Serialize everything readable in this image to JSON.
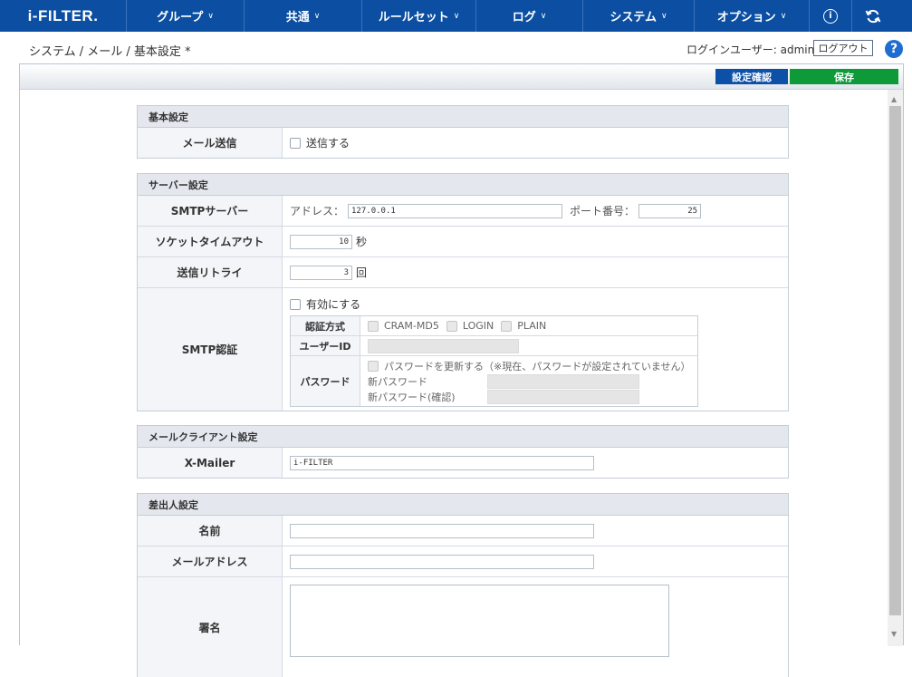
{
  "nav": {
    "logo": "i-FILTER.",
    "items": [
      {
        "label": "グループ"
      },
      {
        "label": "共通"
      },
      {
        "label": "ルールセット"
      },
      {
        "label": "ログ"
      },
      {
        "label": "システム"
      },
      {
        "label": "オプション"
      }
    ],
    "icons": [
      "info-icon",
      "refresh-icon"
    ]
  },
  "breadcrumb": "システム / メール / 基本設定 *",
  "login_user": "ログインユーザー: admin",
  "logout_label": "ログアウト",
  "help_glyph": "?",
  "toolbar": {
    "confirm_label": "設定確認",
    "save_label": "保存"
  },
  "basic": {
    "title": "基本設定",
    "mail_send_label": "メール送信",
    "mail_send_option": "送信する"
  },
  "server": {
    "title": "サーバー設定",
    "smtp_label": "SMTPサーバー",
    "address_label": "アドレス：",
    "address_value": "127.0.0.1",
    "port_label": "ポート番号：",
    "port_value": "25",
    "timeout_label": "ソケットタイムアウト",
    "timeout_value": "10",
    "timeout_unit": "秒",
    "retry_label": "送信リトライ",
    "retry_value": "3",
    "retry_unit": "回",
    "auth_label": "SMTP認証",
    "auth_enable": "有効にする",
    "auth_method_label": "認証方式",
    "auth_methods": [
      "CRAM-MD5",
      "LOGIN",
      "PLAIN"
    ],
    "user_id_label": "ユーザーID",
    "password_label": "パスワード",
    "password_update": "パスワードを更新する（※現在、パスワードが設定されていません）",
    "new_password_label": "新パスワード",
    "new_password_confirm_label": "新パスワード(確認)"
  },
  "client": {
    "title": "メールクライアント設定",
    "xmailer_label": "X-Mailer",
    "xmailer_value": "i-FILTER"
  },
  "sender": {
    "title": "差出人設定",
    "name_label": "名前",
    "email_label": "メールアドレス",
    "signature_label": "署名"
  }
}
